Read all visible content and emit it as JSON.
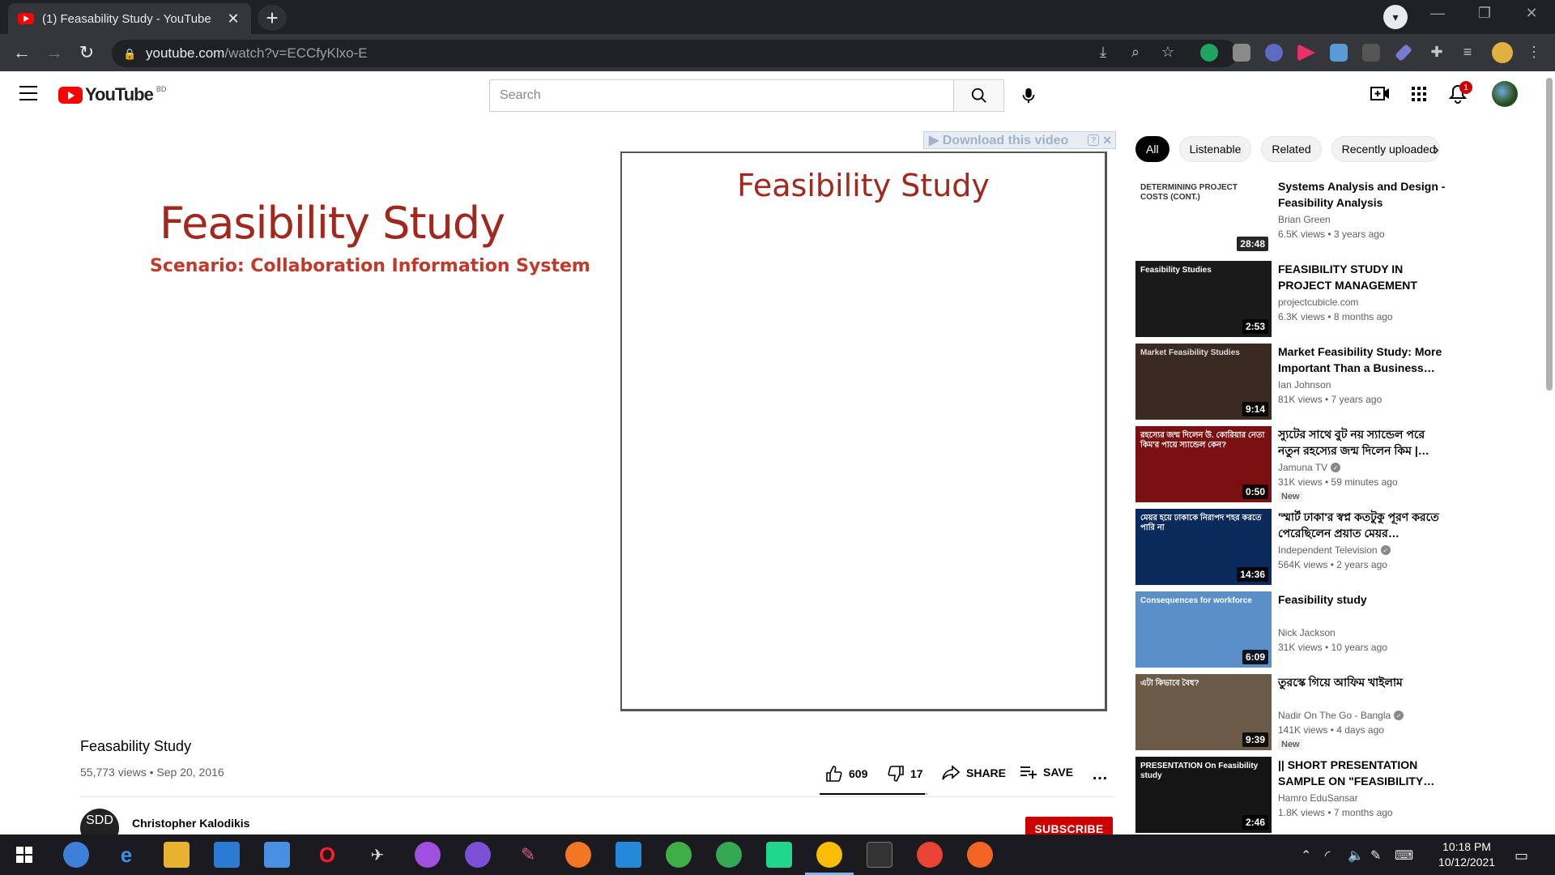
{
  "browser": {
    "tab_title": "(1) Feasability Study - YouTube",
    "url_host": "youtube.com",
    "url_rest": "/watch?v=ECCfyKlxo-E"
  },
  "youtube": {
    "logo_text": "YouTube",
    "region": "BD",
    "search_placeholder": "Search",
    "notification_count": "1"
  },
  "player": {
    "slide_title": "Feasibility Study",
    "slide_subtitle": "Scenario: Collaboration Information System",
    "frame_title": "Feasibility Study",
    "download_banner": "▶ Download this video",
    "download_help": "?",
    "download_close": "✕"
  },
  "video": {
    "title": "Feasability Study",
    "meta": "55,773 views • Sep 20, 2016",
    "likes": "609",
    "dislikes": "17",
    "like_ratio": 0.973,
    "share_label": "SHARE",
    "save_label": "SAVE",
    "more_label": "…",
    "channel_name": "Christopher Kalodikis",
    "channel_avatar_text": "SDD",
    "subscribe_label": "SUBSCRIBE"
  },
  "chips": [
    "All",
    "Listenable",
    "Related",
    "Recently uploaded"
  ],
  "recommendations": [
    {
      "title": "Systems Analysis and Design - Feasibility Analysis",
      "channel": "Brian Green",
      "stats": "6.5K views • 3 years ago",
      "duration": "28:48",
      "verified": false,
      "new": ""
    },
    {
      "title": "FEASIBILITY STUDY IN PROJECT MANAGEMENT",
      "channel": "projectcubicle.com",
      "stats": "6.3K views • 8 months ago",
      "duration": "2:53",
      "verified": false,
      "new": ""
    },
    {
      "title": "Market Feasibility Study: More Important Than a Business…",
      "channel": "Ian Johnson",
      "stats": "81K views • 7 years ago",
      "duration": "9:14",
      "verified": false,
      "new": ""
    },
    {
      "title": "স্যুটের সাথে বুট নয় স্যান্ডেল পরে নতুন রহস্যের জন্ম দিলেন কিম |…",
      "channel": "Jamuna TV",
      "stats": "31K views • 59 minutes ago",
      "duration": "0:50",
      "verified": true,
      "new": "New"
    },
    {
      "title": "'স্মার্ট ঢাকা'র স্বপ্ন কতটুকু পূরণ করতে পেরেছিলেন প্রয়াত মেয়র…",
      "channel": "Independent Television",
      "stats": "564K views • 2 years ago",
      "duration": "14:36",
      "verified": true,
      "new": ""
    },
    {
      "title": "Feasibility study",
      "channel": "Nick Jackson",
      "stats": "31K views • 10 years ago",
      "duration": "6:09",
      "verified": false,
      "new": ""
    },
    {
      "title": "তুরস্কে গিয়ে আফিম খাইলাম",
      "channel": "Nadir On The Go - Bangla",
      "stats": "141K views • 4 days ago",
      "duration": "9:39",
      "verified": true,
      "new": "New"
    },
    {
      "title": "|| SHORT PRESENTATION SAMPLE ON \"FEASIBILITY…",
      "channel": "Hamro EduSansar",
      "stats": "1.8K views • 7 months ago",
      "duration": "2:46",
      "verified": false,
      "new": ""
    }
  ],
  "thumbnails": [
    {
      "text": "DETERMINING PROJECT COSTS (CONT.)",
      "bg": "#ffffff",
      "fg": "#333333"
    },
    {
      "text": "Feasibility Studies",
      "bg": "#1a1a1a",
      "fg": "#ffffff"
    },
    {
      "text": "Market Feasibility Studies",
      "bg": "#3a2a22",
      "fg": "#dddddd"
    },
    {
      "text": "রহস্যের জন্ম দিলেন উ. কোরিয়ার নেতা কিম'র পায়ে স্যান্ডেল কেন?",
      "bg": "#7a1010",
      "fg": "#ffffff"
    },
    {
      "text": "মেয়র হয়ে ঢাকাকে নিরাপদ শহর করতে পারি না",
      "bg": "#0b2a5c",
      "fg": "#ffffff"
    },
    {
      "text": "Consequences for workforce",
      "bg": "#5b8fc7",
      "fg": "#ffffff"
    },
    {
      "text": "এটা কিভাবে বৈধ?",
      "bg": "#6b5a48",
      "fg": "#ffffff"
    },
    {
      "text": "PRESENTATION On Feasibility study",
      "bg": "#151515",
      "fg": "#ffffff"
    }
  ],
  "taskbar": {
    "time": "10:18 PM",
    "date": "10/12/2021"
  }
}
